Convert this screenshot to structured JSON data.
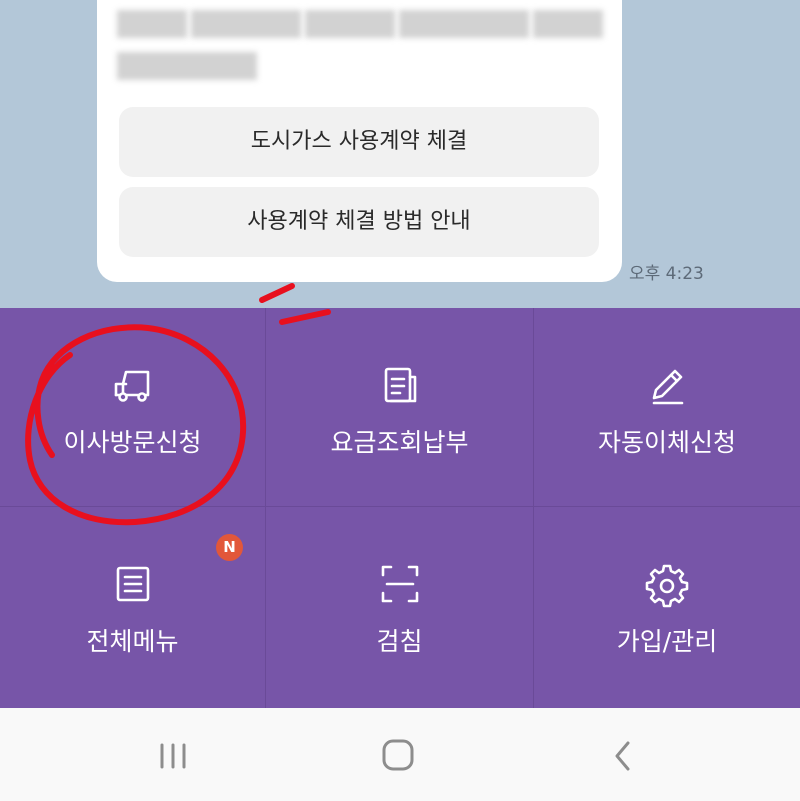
{
  "chat": {
    "buttons": [
      "도시가스 사용계약 체결",
      "사용계약 체결 방법 안내"
    ],
    "timestamp": "오후 4:23"
  },
  "menu": {
    "items": [
      {
        "label": "이사방문신청",
        "icon": "truck-icon"
      },
      {
        "label": "요금조회납부",
        "icon": "document-icon"
      },
      {
        "label": "자동이체신청",
        "icon": "pencil-icon"
      },
      {
        "label": "전체메뉴",
        "icon": "list-icon",
        "badge": "N"
      },
      {
        "label": "검침",
        "icon": "scan-icon"
      },
      {
        "label": "가입/관리",
        "icon": "gear-icon"
      }
    ]
  },
  "nav": {
    "icons": [
      "recent-apps-icon",
      "home-icon",
      "back-icon"
    ]
  },
  "colors": {
    "menu_bg": "#7755a8",
    "chat_bg": "#b3c7d8",
    "badge": "#e2573a",
    "annotation": "#e8101e"
  }
}
